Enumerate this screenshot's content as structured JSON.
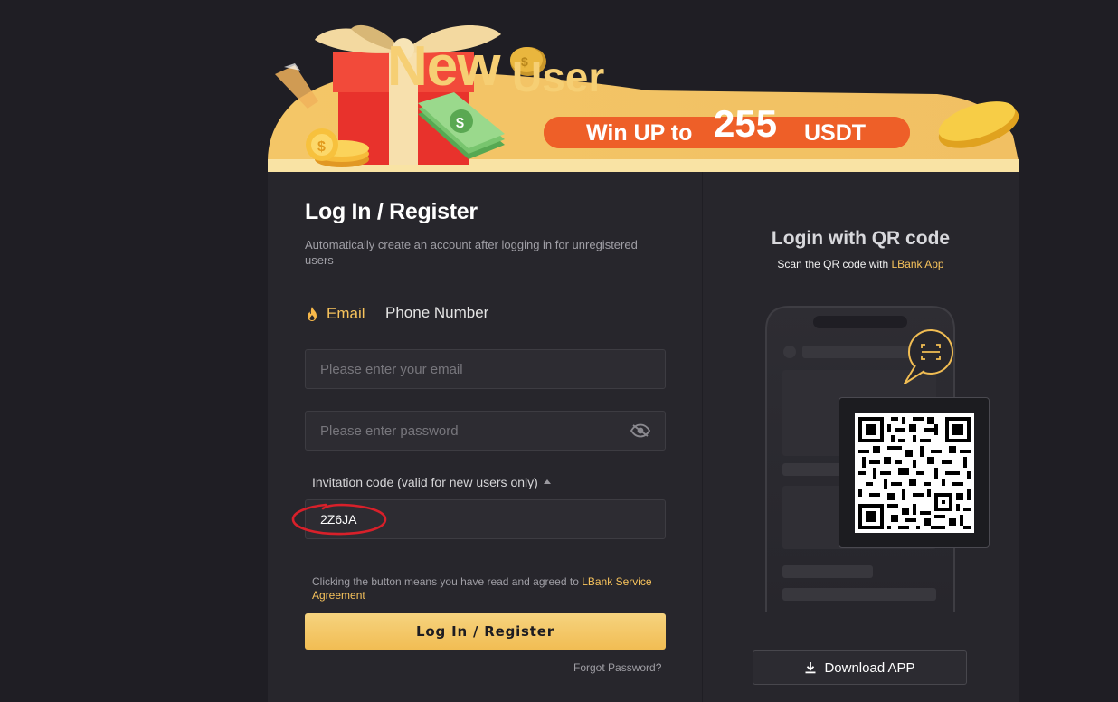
{
  "banner": {
    "title_new": "New",
    "title_user": "User",
    "promo_prefix": "Win UP to",
    "promo_amount": "255",
    "promo_unit": "USDT",
    "icons": [
      "gift-box-icon",
      "coin-icon",
      "cash-stack-icon"
    ]
  },
  "login": {
    "title": "Log In / Register",
    "subtitle": "Automatically create an account after logging in for unregistered users",
    "tabs": [
      {
        "label": "Email",
        "active": true,
        "icon": "fire-icon"
      },
      {
        "label": "Phone Number",
        "active": false
      }
    ],
    "email_placeholder": "Please enter your email",
    "email_value": "",
    "password_placeholder": "Please enter password",
    "password_value": "",
    "invite_label": "Invitation code (valid for new users only)",
    "invite_value": "2Z6JA",
    "agree_prefix": "Clicking the button means you have read and agreed to ",
    "agree_link": "LBank Service Agreement",
    "button_label": "Log In / Register",
    "forgot_label": "Forgot Password?"
  },
  "qr": {
    "title": "Login with QR code",
    "subtitle_prefix": "Scan the QR code with ",
    "subtitle_link": "LBank App",
    "download_label": "Download APP"
  },
  "colors": {
    "accent": "#f7c35c",
    "background": "#1f1e24",
    "panel": "#27262c",
    "promo_orange": "#ee5f28",
    "annotation_red": "#d8202a"
  }
}
